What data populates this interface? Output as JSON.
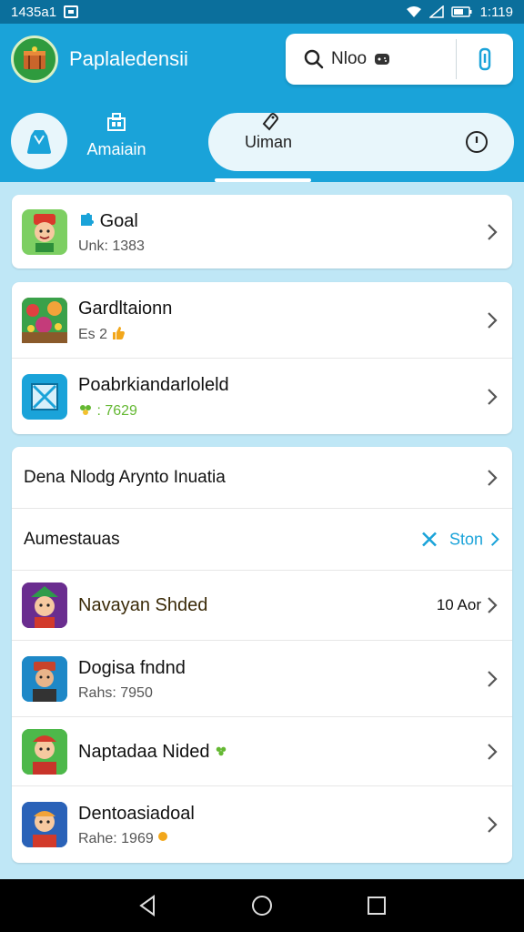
{
  "status_bar": {
    "time_left": "1435a1",
    "time_right": "1:119"
  },
  "header": {
    "title": "Paplaledensii",
    "search_text": "Nloo"
  },
  "tabs": {
    "left_label": "Amaiain",
    "pill_label": "Uiman"
  },
  "card1": {
    "title": "Goal",
    "subtitle": "Unk: 1383"
  },
  "card2": {
    "items": [
      {
        "title": "Gardltaionn",
        "subtitle": "Es 2"
      },
      {
        "title": "Poabrkiandarloleld",
        "subtitle": ": 7629"
      }
    ]
  },
  "card3": {
    "row1": "Dena Nlodg Arynto Inuatia",
    "row2_label": "Aumestauas",
    "row2_action": "Ston",
    "items": [
      {
        "title": "Navayan Shded",
        "right": "10 Aor"
      },
      {
        "title": "Dogisa fndnd",
        "subtitle": "Rahs: 7950"
      },
      {
        "title": "Naptadaa Nided"
      },
      {
        "title": "Dentoasiadoal",
        "subtitle": "Rahe: 1969"
      }
    ]
  },
  "colors": {
    "primary": "#1aa3d9",
    "status_bar": "#0b6f9c",
    "background": "#bfe7f6",
    "accent": "#1aa3d9",
    "green": "#64b832"
  }
}
